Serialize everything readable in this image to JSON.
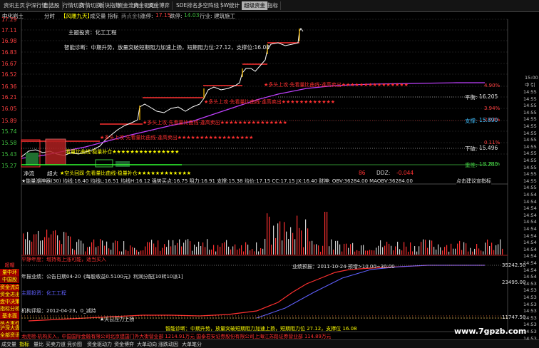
{
  "top_tabs": [
    "资讯主页",
    "沪深行情",
    "自选股",
    "行情切换",
    "行情切换",
    "板块指数",
    "资金流向",
    "资金驱动",
    "资金博弈",
    "SDE排名",
    "多空阵线",
    "SW统计",
    "超级资金",
    "指标"
  ],
  "header": {
    "stock": "中化岩土",
    "period": "分时",
    "indicator": "【风雕九天】",
    "volume_label": "成交量",
    "indicator_label": "指标",
    "hint": "两点金标",
    "up_label": "涨停:",
    "up_value": "17.15",
    "down_label": "跌停:",
    "down_value": "14.03",
    "industry_label": "行业:",
    "industry_value": "建筑施工"
  },
  "price_axis": [
    "17.29",
    "17.11",
    "16.98",
    "16.83",
    "16.67",
    "16.52",
    "16.36",
    "16.21",
    "16.05",
    "15.89",
    "15.74",
    "15.58",
    "15.43",
    "15.27"
  ],
  "pct_axis": [
    "4.90%",
    "3.94%",
    "2.03%",
    "0.11%",
    "1.81%"
  ],
  "annotations": {
    "theme": "主题投资：化工工程",
    "diagnosis": "智能诊断：中期升势，放量突破短期阻力加速上扬，短期阻力位:27.12，支撑位:16.08",
    "pingheng": "平衡:",
    "pingheng_val": "16.205",
    "zhicheng": "支撑:",
    "zhicheng_val": "15.890",
    "xiapo": "下破:",
    "xiapo_val": "15.496",
    "zhusheng": "重推:",
    "zhusheng_val": "15.280",
    "red_line1": "★多头上攻·先看量比曲线·逢高卖出★★★★★★★★★★★★★★★",
    "red_line2": "★多头上攻·先看量比曲线·逢高卖出★★★★★★★★★★★★",
    "red_line3": "★多头上攻·先看量比曲线·逢高卖出★★★★★★★★★★★★★★★",
    "red_line4": "★多头上攻·先看量比曲线·逢高卖出★★★★★★★★★★★★★★★★★",
    "yellow_line1": "看量比曲线·稳量补仓★★★★★★★★★★★★★★★",
    "yellow_line2": "★空头回踩·先看量比曲线·稳量补仓★★★★★★★★★★★★",
    "jingliu": "净流",
    "chaoda": "超大",
    "ddz_num": "86",
    "ddz_label": "DDZ:",
    "ddz_value": "-0.044"
  },
  "volume_header": "★能量潮神器(30) 均线:16.40 均线L:16.51 均线H:16.12 强势买点:16.75 阻力:16.91 支撑:15.38 均价:17.15 CC:17.15 JX:16.40 财神:  OBV:36284.00  MAOBV:36284.00",
  "tooltip": "点击建议宣指标",
  "sidebar_top": [
    "超帽",
    "量中环",
    "中国股",
    "资金流向",
    "资金进出",
    "盘中决策",
    "指标分析",
    "基本面",
    "热点事件",
    "强弱走势",
    "操作大势"
  ],
  "sidebar_bottom": [
    "沪深大盘",
    "全部资讯",
    "阅读文章"
  ],
  "lower_text": {
    "l1": "平静年度：增持有上涨可能，适当买入",
    "l2": "年报业绩：公告日期04-20《每股收益0.5100元》利润分配[10转10派1]",
    "l3": "主题投资：化工工程",
    "l4": "机构评级：2012-04-23，0_减持",
    "l5": "业绩预报：2011-10-24·预增>10.00~30.00",
    "l6": "★天云压力上扬",
    "l7": "智能诊断：中期升势，放量突破短期阻力加速上扬，短期阻力位 27.12，支撑位 16.08",
    "l8": "龙虎榜·机构买入，中国国际金融有限公司北京建国门外大街营业部 1214.91万元  国泰君安证券股份有限公司上海江苏路证券营业部 114.89万元",
    "top_label": "平静年度：",
    "right_vals": [
      "35242.50",
      "23495.00",
      "11747.50"
    ]
  },
  "bottom_tabs": [
    "成交量",
    "指标",
    "量比",
    "买卖力道",
    "竞价图",
    "资金驱动力",
    "资金博弈",
    "大单动向",
    "涨跌动因",
    "大单笔分"
  ],
  "watermark": "www.7gpzb.com",
  "right_panel": {
    "labels": [
      "中",
      "引",
      "15:00"
    ],
    "times": [
      "14:55",
      "14:55",
      "14:55",
      "14:55",
      "14:55",
      "14:55",
      "14:55",
      "14:55",
      "14:55",
      "14:55",
      "14:55",
      "14:55",
      "14:55",
      "14:55",
      "14:55",
      "14:54",
      "14:54",
      "14:54",
      "14:54",
      "14:54",
      "14:54",
      "14:54",
      "14:54",
      "14:54",
      "14:54",
      "14:54",
      "14:54",
      "14:54",
      "14:53",
      "14:53",
      "14:53",
      "14:53",
      "14:53",
      "14:53",
      "14:53",
      "14:53",
      "14:53"
    ]
  },
  "colors": {
    "up": "#ff4040",
    "down": "#40c040",
    "accent": "#ffff00",
    "magenta": "#c040ff"
  }
}
